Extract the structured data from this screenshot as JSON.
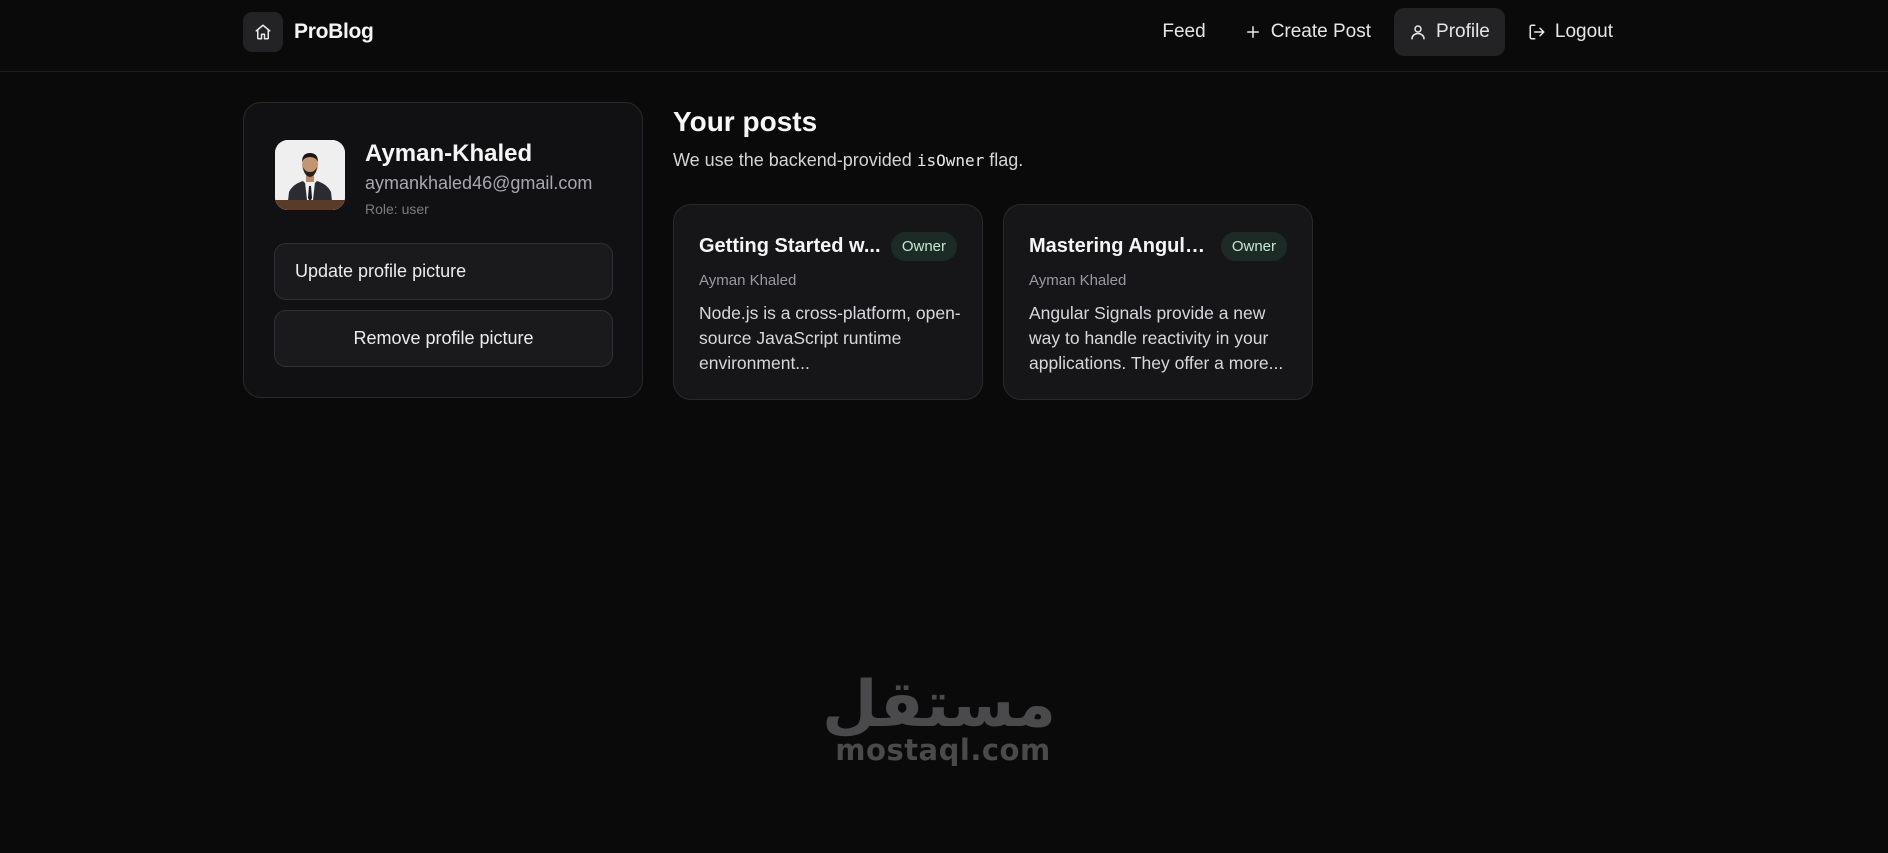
{
  "app": {
    "brand": "ProBlog"
  },
  "nav": {
    "items": [
      {
        "label": "Feed",
        "icon": "none",
        "active": false
      },
      {
        "label": "Create Post",
        "icon": "plus-icon",
        "active": false
      },
      {
        "label": "Profile",
        "icon": "user-icon",
        "active": true
      },
      {
        "label": "Logout",
        "icon": "logout-icon",
        "active": false
      }
    ]
  },
  "profile": {
    "name": "Ayman-Khaled",
    "email": "aymankhaled46@gmail.com",
    "role": "Role: user",
    "update_label": "Update profile picture",
    "remove_label": "Remove profile picture"
  },
  "posts_section": {
    "title": "Your posts",
    "subtitle_prefix": "We use the backend-provided ",
    "subtitle_code": "isOwner",
    "subtitle_suffix": " flag."
  },
  "posts": [
    {
      "title": "Getting Started w...",
      "badge": "Owner",
      "author": "Ayman Khaled",
      "excerpt": "Node.js is a cross-platform, open-source JavaScript runtime environment..."
    },
    {
      "title": "Mastering Angula...",
      "badge": "Owner",
      "author": "Ayman Khaled",
      "excerpt": "Angular Signals provide a new way to handle reactivity in your applications. They offer a more..."
    }
  ],
  "watermark": {
    "arabic": "مستقل",
    "latin": "mostaql.com"
  },
  "colors": {
    "background": "#0a0a0b",
    "card": "#111113",
    "badge_bg": "#1c2b25",
    "badge_text": "#c7e6d6"
  }
}
